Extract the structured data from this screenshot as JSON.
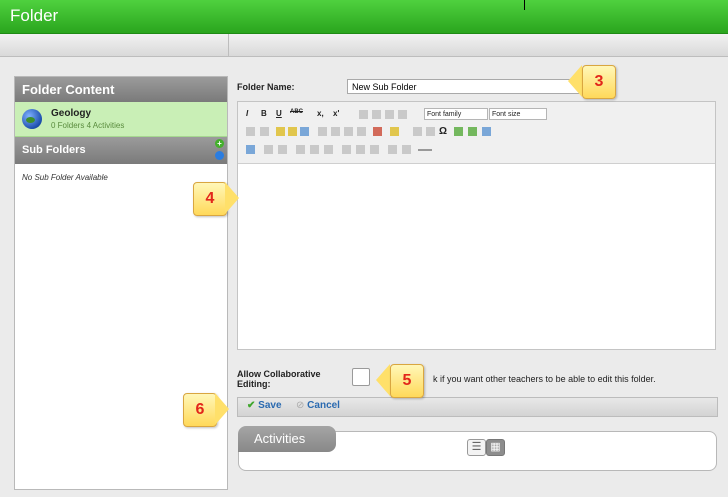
{
  "window": {
    "title": "Folder"
  },
  "left_panel": {
    "header": "Folder Content",
    "folder": {
      "name": "Geology",
      "stats": "0 Folders 4 Activities"
    },
    "subfolders_header": "Sub Folders",
    "add_icon_glyph": "+",
    "empty_text": "No Sub Folder Available"
  },
  "form": {
    "folder_name_label": "Folder Name:",
    "folder_name_value": "New Sub Folder",
    "font_family": "Font family",
    "font_size": "Font size",
    "collab_label_line1": "Allow Collaborative",
    "collab_label_line2": "Editing:",
    "collab_text": "k if you want other teachers to be able to edit this folder.",
    "save_label": "Save",
    "cancel_label": "Cancel"
  },
  "activities": {
    "tab_label": "Activities",
    "list_view_glyph": "☰",
    "grid_view_glyph": "▦"
  },
  "toolbar_glyphs": {
    "bold": "B",
    "italic": "I",
    "underline": "U",
    "strike": "ABC",
    "subscript": "x,",
    "superscript": "x'",
    "omega": "Ω"
  },
  "callouts": [
    "3",
    "4",
    "5",
    "6"
  ],
  "colors": {
    "titlebar": "#2aa51e",
    "accent_green": "#c9efb6",
    "link_blue": "#2a6ab0",
    "callout_fill": "#ffd95a",
    "callout_text": "#e2261b"
  }
}
